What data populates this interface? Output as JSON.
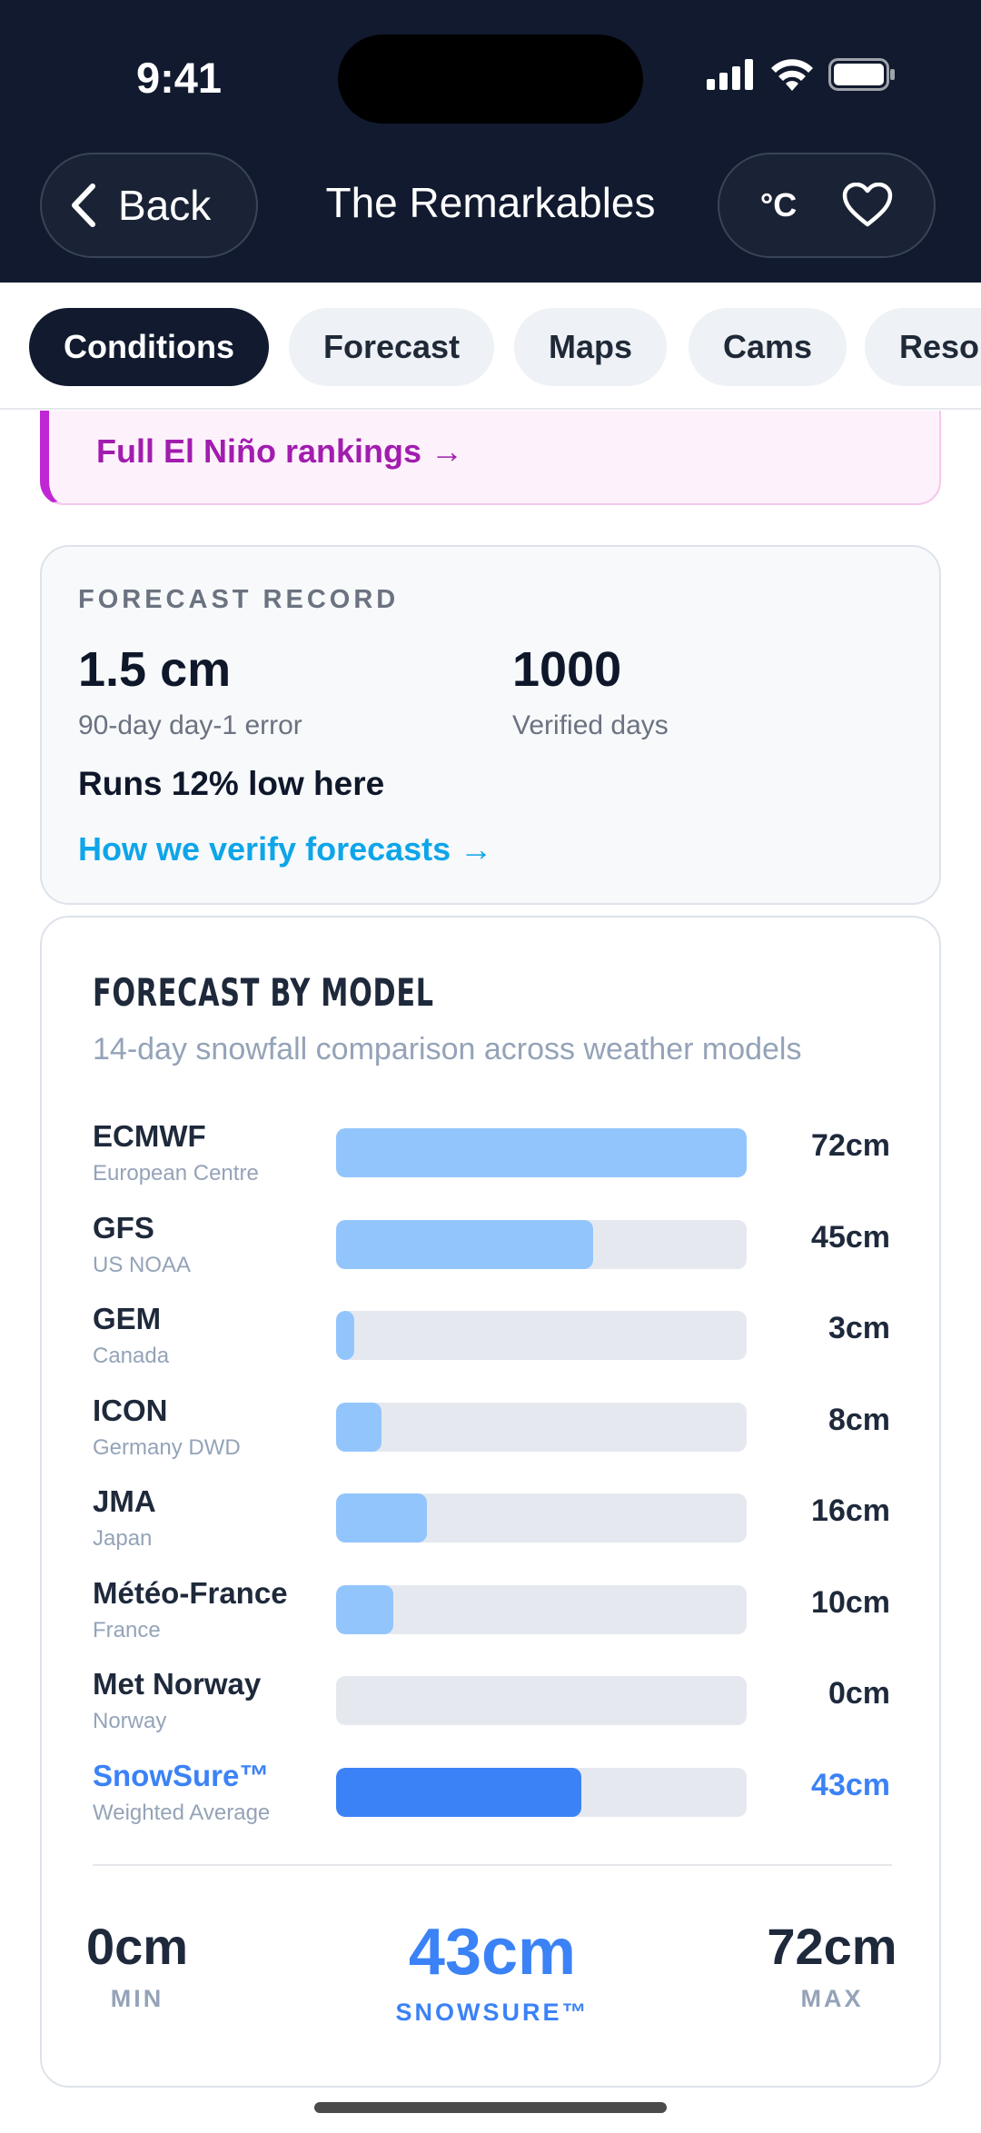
{
  "status_bar": {
    "time": "9:41"
  },
  "nav": {
    "back_label": "Back",
    "title": "The Remarkables",
    "unit_label": "°C",
    "icons": {
      "back": "chevron-left-icon",
      "favorite": "heart-icon"
    }
  },
  "tabs": [
    {
      "label": "Conditions",
      "active": true
    },
    {
      "label": "Forecast",
      "active": false
    },
    {
      "label": "Maps",
      "active": false
    },
    {
      "label": "Cams",
      "active": false
    },
    {
      "label": "Resor",
      "active": false
    }
  ],
  "elnino": {
    "link_label": "Full El Niño rankings →",
    "accent": "#c026d3"
  },
  "forecast_record": {
    "label": "FORECAST RECORD",
    "error_value": "1.5 cm",
    "error_caption": "90-day day-1 error",
    "days_value": "1000",
    "days_caption": "Verified days",
    "bias_note": "Runs 12% low here",
    "link_label": "How we verify forecasts →"
  },
  "models": {
    "title": "FORECAST BY MODEL",
    "subtitle": "14-day snowfall comparison across weather models",
    "max_cm": 72,
    "rows": [
      {
        "name": "ECMWF",
        "org": "European Centre",
        "value_label": "72cm",
        "value": 72,
        "highlight": false
      },
      {
        "name": "GFS",
        "org": "US NOAA",
        "value_label": "45cm",
        "value": 45,
        "highlight": false
      },
      {
        "name": "GEM",
        "org": "Canada",
        "value_label": "3cm",
        "value": 3,
        "highlight": false
      },
      {
        "name": "ICON",
        "org": "Germany DWD",
        "value_label": "8cm",
        "value": 8,
        "highlight": false
      },
      {
        "name": "JMA",
        "org": "Japan",
        "value_label": "16cm",
        "value": 16,
        "highlight": false
      },
      {
        "name": "Météo-France",
        "org": "France",
        "value_label": "10cm",
        "value": 10,
        "highlight": false
      },
      {
        "name": "Met Norway",
        "org": "Norway",
        "value_label": "0cm",
        "value": 0,
        "highlight": false
      },
      {
        "name": "SnowSure™",
        "org": "Weighted Average",
        "value_label": "43cm",
        "value": 43,
        "highlight": true
      }
    ],
    "summary": {
      "min_value": "0cm",
      "min_label": "MIN",
      "center_value": "43cm",
      "center_label": "SNOWSURE™",
      "max_value": "72cm",
      "max_label": "MAX"
    },
    "colors": {
      "bar": "#93c5fd",
      "highlight": "#3b82f6",
      "track": "#e5e9ef"
    }
  }
}
